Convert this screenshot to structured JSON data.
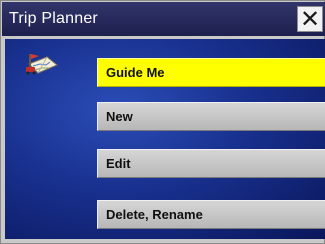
{
  "window": {
    "title": "Trip Planner",
    "close_glyph": "✕"
  },
  "menu": {
    "items": [
      {
        "label": "Guide Me",
        "selected": true
      },
      {
        "label": "New",
        "selected": false
      },
      {
        "label": "Edit",
        "selected": false
      },
      {
        "label": "Delete, Rename",
        "selected": false
      }
    ]
  },
  "theme": {
    "title_bar": "#1d1f4d",
    "content_background": "#18308e",
    "selected_item": "#ffff00",
    "item_background": "#c8c8c8"
  },
  "icons": {
    "app_icon": "trip-planner-icon",
    "close_icon": "close-icon"
  }
}
